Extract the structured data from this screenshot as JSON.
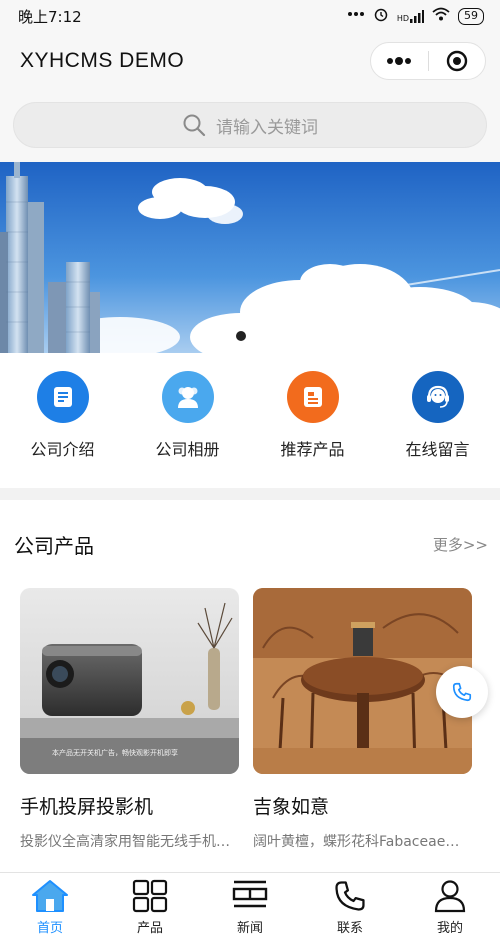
{
  "status_bar": {
    "time": "晚上7:12",
    "signal_text": "HD",
    "battery": "59"
  },
  "app": {
    "title": "XYHCMS DEMO"
  },
  "search": {
    "placeholder": "请输入关键词"
  },
  "banner": {
    "slides": 2,
    "active_index": 0
  },
  "quick_nav": [
    {
      "label": "公司介绍",
      "icon": "document-icon",
      "color": "#1e7fe6"
    },
    {
      "label": "公司相册",
      "icon": "person-icon",
      "color": "#4aa8ee"
    },
    {
      "label": "推荐产品",
      "icon": "clipboard-icon",
      "color": "#f26b1d"
    },
    {
      "label": "在线留言",
      "icon": "headset-icon",
      "color": "#1565c0"
    }
  ],
  "products_section": {
    "title": "公司产品",
    "more_label": "更多>>",
    "items": [
      {
        "name": "手机投屏投影机",
        "desc": "投影仪全高清家用智能无线手机…",
        "image_caption": "本产品无开关机广告，畅快观影开机即享"
      },
      {
        "name": "吉象如意",
        "desc": "阔叶黄檀，蝶形花科Fabaceae，…"
      }
    ]
  },
  "tab_bar": [
    {
      "label": "首页",
      "icon": "home-icon",
      "active": true
    },
    {
      "label": "产品",
      "icon": "grid-icon",
      "active": false
    },
    {
      "label": "新闻",
      "icon": "news-icon",
      "active": false
    },
    {
      "label": "联系",
      "icon": "phone-icon",
      "active": false
    },
    {
      "label": "我的",
      "icon": "user-icon",
      "active": false
    }
  ],
  "colors": {
    "accent": "#1e90ff",
    "background": "#f7f7f7"
  }
}
